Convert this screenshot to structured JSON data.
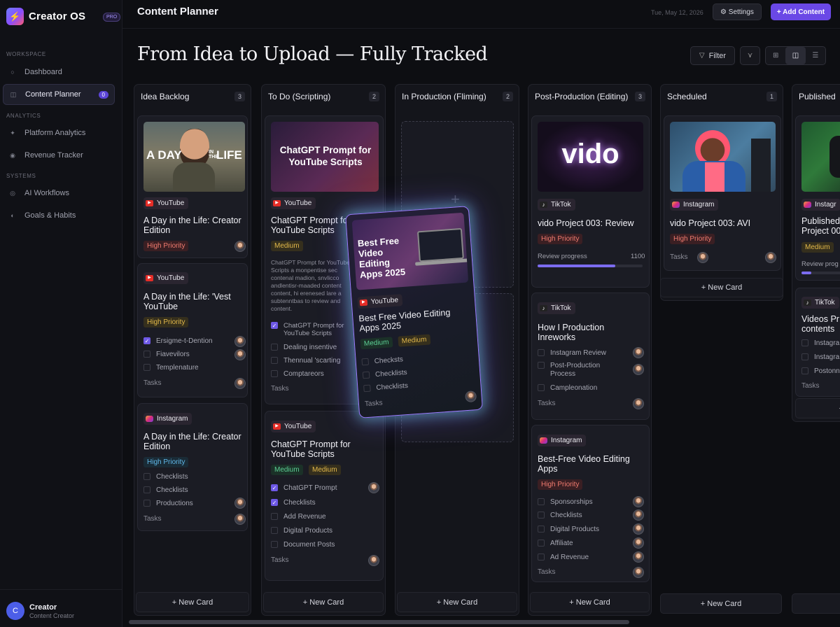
{
  "app": {
    "name": "Creator OS",
    "badge": "PRO",
    "logo_glyph": "⚡"
  },
  "sidebar": {
    "sections": [
      {
        "label": "WORKSPACE"
      },
      {
        "label": "ANALYTICS"
      },
      {
        "label": "SYSTEMS"
      }
    ],
    "items": [
      {
        "label": "Dashboard",
        "icon": "circle-icon"
      },
      {
        "label": "Content Planner",
        "icon": "board-icon",
        "count": "0"
      },
      {
        "label": "Platform Analytics",
        "icon": "sparkle-icon"
      },
      {
        "label": "Revenue Tracker",
        "icon": "target-icon"
      },
      {
        "label": "AI Workflows",
        "icon": "ring-icon"
      },
      {
        "label": "Goals & Habits",
        "icon": "half-circle-icon"
      }
    ],
    "user": {
      "initial": "C",
      "name": "Creator",
      "role": "Content Creator"
    }
  },
  "header": {
    "title": "Content Planner",
    "date": "Tue, May 12, 2026",
    "settings_label": "⚙ Settings",
    "add_label": "+ Add Content",
    "hero": "From Idea to Upload — Fully Tracked",
    "filter_label": "Filter"
  },
  "colors": {
    "accent": "#6a48e6",
    "high": "#f07b6f",
    "medium": "#e2b84a"
  },
  "columns": [
    {
      "title": "Idea Backlog",
      "count": "3",
      "footer": "+ New Card"
    },
    {
      "title": "To Do (Scripting)",
      "count": "2",
      "footer": "+ New Card"
    },
    {
      "title": "In Production (Fliming)",
      "count": "2",
      "footer": "+ New Card"
    },
    {
      "title": "Post-Production (Editing)",
      "count": "3",
      "footer": "+ New Card"
    },
    {
      "title": "Scheduled",
      "count": "1",
      "footer": "+ New Card"
    },
    {
      "title": "Published",
      "count": "",
      "footer": "+"
    }
  ],
  "cards": {
    "c1": {
      "thumb_text_1": "A DAY",
      "thumb_text_2": "LIFE",
      "thumb_text_mid": "IN THE",
      "platform": "YouTube",
      "title": "A Day in the Life: Creator Edition",
      "tag": "High Priority"
    },
    "c2": {
      "platform": "YouTube",
      "title": "A Day in the Life: 'Vest YouTube",
      "tag": "High Priority",
      "checks": [
        "Ersigme-t-Dention",
        "Fiavevilors",
        "Templenature"
      ],
      "tasks": "Tasks"
    },
    "c3": {
      "platform": "Instagram",
      "title": "A Day in the Life: Creator Edition",
      "tag": "High Priority",
      "checks": [
        "Checklists",
        "Checklists",
        "Productions"
      ],
      "tasks": "Tasks"
    },
    "c4": {
      "thumb_text": "ChatGPT Prompt for YouTube Scripts",
      "platform": "YouTube",
      "title": "ChatGPT Prompt for YouTube Scripts",
      "tag": "Medium",
      "desc": "ChatGPT Prompt for YouTube Scripts a monpentise sec contenal madion, snvlicco andlentisr-maaded content content, hi erenesed lare a subtenntbas to review and content.",
      "checks": [
        "ChatGPT Prompt for YouTube Scripts",
        "Dealing insentive",
        "Thennual 'scarting",
        "Comptareors"
      ],
      "tasks": "Tasks"
    },
    "c5": {
      "platform": "YouTube",
      "title": "ChatGPT Prompt for YouTube Scripts",
      "tag1": "Medium",
      "tag2": "Medium",
      "checks": [
        "ChatGPT Prompt",
        "Checklists",
        "Add Revenue",
        "Digital Products",
        "Document Posts"
      ],
      "tasks": "Tasks"
    },
    "c6": {
      "thumb_text": "vido",
      "platform": "TikTok",
      "title": "vido Project 003: Review",
      "tag": "High Priority",
      "progress_label": "Review progress",
      "progress_value": "1100",
      "progress": 0.74
    },
    "c7": {
      "platform": "TikTok",
      "title": "How I Production Inreworks",
      "checks": [
        "Instagram Review",
        "Post-Production Process",
        "Campleonation"
      ],
      "tasks": "Tasks"
    },
    "c8": {
      "platform": "Instagram",
      "title": "Best-Free Video Editing Apps",
      "tag": "High Priority",
      "checks": [
        "Sponsorships",
        "Checklists",
        "Digital Products",
        "Affiliate",
        "Ad Revenue"
      ],
      "tasks": "Tasks"
    },
    "c9": {
      "platform": "Instagram",
      "title": "vido Project 003: AVI",
      "tag": "High Priority",
      "tasks": "Tasks",
      "add": "+ New Card"
    },
    "c10": {
      "platform": "Instagr",
      "title": "Published Project 00",
      "tag": "Medium",
      "progress_label": "Review prog",
      "progress": 0.2
    },
    "c11": {
      "platform": "TikTok",
      "title": "Videos Pr contents",
      "checks": [
        "Instagra",
        "Instagra",
        "Postonn"
      ],
      "tasks": "Tasks"
    },
    "drag": {
      "thumb_text": "Best Free Video Editing Apps 2025",
      "platform": "YouTube",
      "title": "Best Free Video Editing Apps 2025",
      "tag1": "Medium",
      "tag2": "Medium",
      "checks": [
        "Checksts",
        "Checklists",
        "Checklists"
      ],
      "tasks": "Tasks"
    }
  }
}
